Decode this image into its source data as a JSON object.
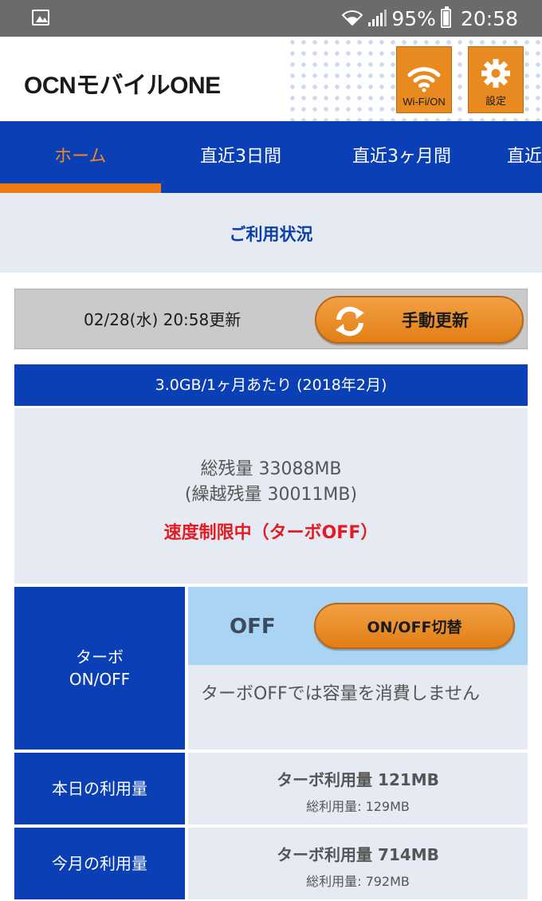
{
  "status_bar": {
    "battery": "95%",
    "time": "20:58"
  },
  "header": {
    "logo": "OCNモバイルONE",
    "wifi_button": "Wi-Fi/ON",
    "settings_button": "設定"
  },
  "tabs": [
    {
      "label": "ホーム",
      "active": true
    },
    {
      "label": "直近3日間"
    },
    {
      "label": "直近3ヶ月間"
    },
    {
      "label": "直近"
    }
  ],
  "section_title": "ご利用状況",
  "update": {
    "timestamp": "02/28(水) 20:58更新",
    "button": "手動更新"
  },
  "plan": "3.0GB/1ヶ月あたり (2018年2月)",
  "remaining": {
    "total": "総残量 33088MB",
    "carryover": "(繰越残量 30011MB)",
    "status": "速度制限中（ターボOFF）"
  },
  "turbo": {
    "label_line1": "ターボ",
    "label_line2": "ON/OFF",
    "state": "OFF",
    "toggle_button": "ON/OFF切替",
    "note": "ターボOFFでは容量を消費しません"
  },
  "usage": {
    "today": {
      "label": "本日の利用量",
      "turbo": "ターボ利用量 121MB",
      "total": "総利用量: 129MB"
    },
    "month": {
      "label": "今月の利用量",
      "turbo": "ターボ利用量 714MB",
      "total": "総利用量: 792MB"
    }
  },
  "colors": {
    "brand_blue": "#0a3fb5",
    "accent_orange": "#e88a1f",
    "alert_red": "#e31b23"
  }
}
